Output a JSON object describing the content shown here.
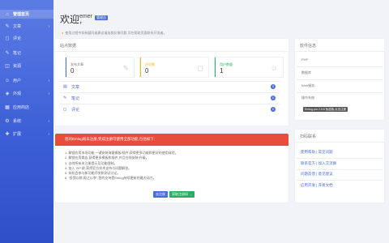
{
  "sidebar": {
    "items": [
      {
        "label": "管理首页",
        "icon": "⌂",
        "active": true
      },
      {
        "label": "文章",
        "icon": "✎",
        "arrow": "›"
      },
      {
        "label": "评论",
        "icon": "◻"
      },
      {
        "label": "笔记",
        "icon": "✎"
      },
      {
        "label": "资源",
        "icon": "◫"
      },
      {
        "label": "用户",
        "icon": "☺",
        "arrow": "›"
      },
      {
        "label": "外观",
        "icon": "◈",
        "arrow": "›"
      },
      {
        "label": "应用商店",
        "icon": "▦"
      },
      {
        "label": "系统",
        "icon": "⚙",
        "arrow": "›"
      },
      {
        "label": "扩展",
        "icon": "✚",
        "arrow": "›"
      }
    ]
  },
  "header": {
    "welcome": "欢迎,",
    "user": "emer",
    "badge": "管理员",
    "tip": "使用过程中如有疑问或建议请加群反馈问题,可在帮助页面联系开发者。"
  },
  "content_panel": {
    "title": "站点数据",
    "stats": [
      {
        "tag": "发布文章",
        "value": "0",
        "color": "#4a6cdc",
        "icon": "✎"
      },
      {
        "tag": "评论数",
        "value": "0",
        "color": "#f5b300",
        "icon": "◻"
      },
      {
        "tag": "用户数量",
        "value": "1",
        "color": "#27ae60",
        "icon": "☺"
      }
    ],
    "rows": [
      {
        "label": "文章",
        "count": "0",
        "icon": "▤"
      },
      {
        "label": "笔记",
        "count": "0",
        "icon": "✎"
      },
      {
        "label": "评论",
        "count": "0",
        "icon": "◻"
      }
    ]
  },
  "system_panel": {
    "title": "软件信息",
    "rows": [
      "PHP",
      "数据库",
      "Web服务",
      "操作系统"
    ],
    "version": "Emlog pro 2.5.8 免费版,点击注册"
  },
  "alert": {
    "text": "您的Emlog尚未注册,完成注册可使用全部功能,包括如下:",
    "steps": [
      "1. 解锁应用市场功能,一键安装海量模板/插件,获得更多功能和更好的使用体验。",
      "2. 解锁应用商店,获得更多模板和插件,并且在线安装/升级。",
      "3. 去除所有未注册提示及功能限制。",
      "4. 加入 VIP 群,获得官方技术支持与问题解答。",
      "5. 有机会参与新功能开发和测试讨论。",
      "6. “投我以桃,报之以李”,您的支持是Emlog持续更新的最大动力。"
    ],
    "register_button": "去注册",
    "buy_button": "获取注册码 →"
  },
  "links_panel": {
    "title": "扫码联系",
    "links": [
      "使用帮助 | 常见问题",
      "联系官方 | 加入交流群",
      "问题反馈 | 意见建议",
      "应用开发 | 开发文档"
    ]
  },
  "colors": {
    "accent": "#4a6cdc",
    "danger": "#e74c3c",
    "success": "#27ae60",
    "warning": "#f5b300"
  }
}
